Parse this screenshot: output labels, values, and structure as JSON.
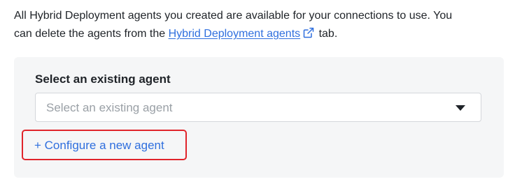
{
  "intro": {
    "text_before_link": "All Hybrid Deployment agents you created are available for your connections to use. You",
    "text_line2_before_link": "can delete the agents from the ",
    "link_label": "Hybrid Deployment agents",
    "text_after_link": " tab."
  },
  "agent_select": {
    "label": "Select an existing agent",
    "placeholder": "Select an existing agent"
  },
  "configure": {
    "label": "+ Configure a new agent"
  },
  "colors": {
    "link": "#2f6fde",
    "highlight": "#e0242b",
    "panel_bg": "#f5f6f7"
  },
  "icons": {
    "external_link": "external-link-icon",
    "caret": "chevron-down-icon"
  }
}
